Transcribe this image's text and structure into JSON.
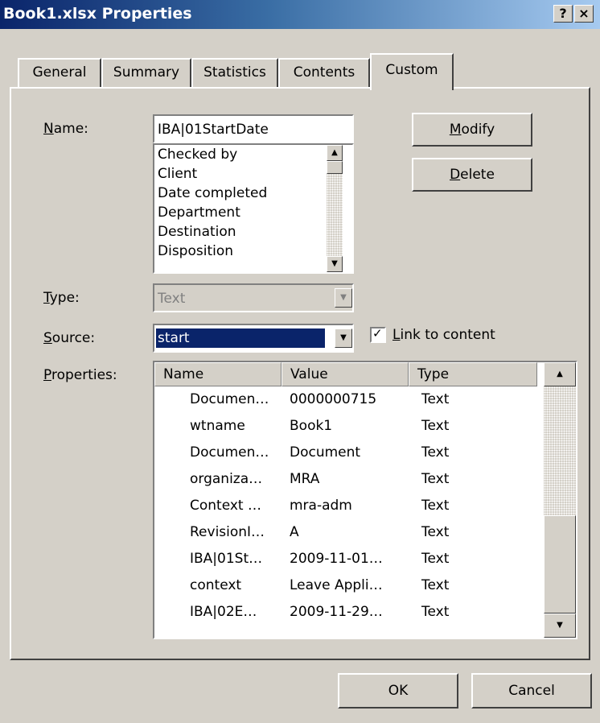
{
  "window": {
    "title": "Book1.xlsx Properties",
    "help_glyph": "?",
    "close_glyph": "×"
  },
  "tabs": [
    {
      "label": "General"
    },
    {
      "label": "Summary"
    },
    {
      "label": "Statistics"
    },
    {
      "label": "Contents"
    },
    {
      "label": "Custom",
      "active": true
    }
  ],
  "form": {
    "name_label": "Name:",
    "name_value": "IBA|01StartDate",
    "name_list": [
      "Checked by",
      "Client",
      "Date completed",
      "Department",
      "Destination",
      "Disposition"
    ],
    "type_label": "Type:",
    "type_value": "Text",
    "source_label": "Source:",
    "source_value": "start",
    "link_label": "Link to content",
    "link_checked": true,
    "properties_label": "Properties:"
  },
  "buttons": {
    "modify": "Modify",
    "delete": "Delete",
    "ok": "OK",
    "cancel": "Cancel"
  },
  "properties_table": {
    "columns": [
      "Name",
      "Value",
      "Type"
    ],
    "rows": [
      {
        "name": "Documen…",
        "value": "0000000715",
        "type": "Text"
      },
      {
        "name": "wtname",
        "value": "Book1",
        "type": "Text"
      },
      {
        "name": "Documen…",
        "value": "Document",
        "type": "Text"
      },
      {
        "name": "organiza…",
        "value": "MRA",
        "type": "Text"
      },
      {
        "name": "Context …",
        "value": "mra-adm",
        "type": "Text"
      },
      {
        "name": "RevisionI…",
        "value": "A",
        "type": "Text"
      },
      {
        "name": "IBA|01St…",
        "value": "2009-11-01…",
        "type": "Text"
      },
      {
        "name": "context",
        "value": "Leave Appli…",
        "type": "Text"
      },
      {
        "name": "IBA|02E…",
        "value": "2009-11-29…",
        "type": "Text"
      }
    ]
  },
  "colors": {
    "titlebar_start": "#0a246a",
    "titlebar_end": "#a6caf0",
    "selection": "#0a246a",
    "face": "#d4d0c8"
  },
  "icons": [
    "help-icon",
    "close-icon",
    "scroll-up-icon",
    "scroll-down-icon",
    "dropdown-arrow-icon",
    "checkbox-checked-icon"
  ]
}
